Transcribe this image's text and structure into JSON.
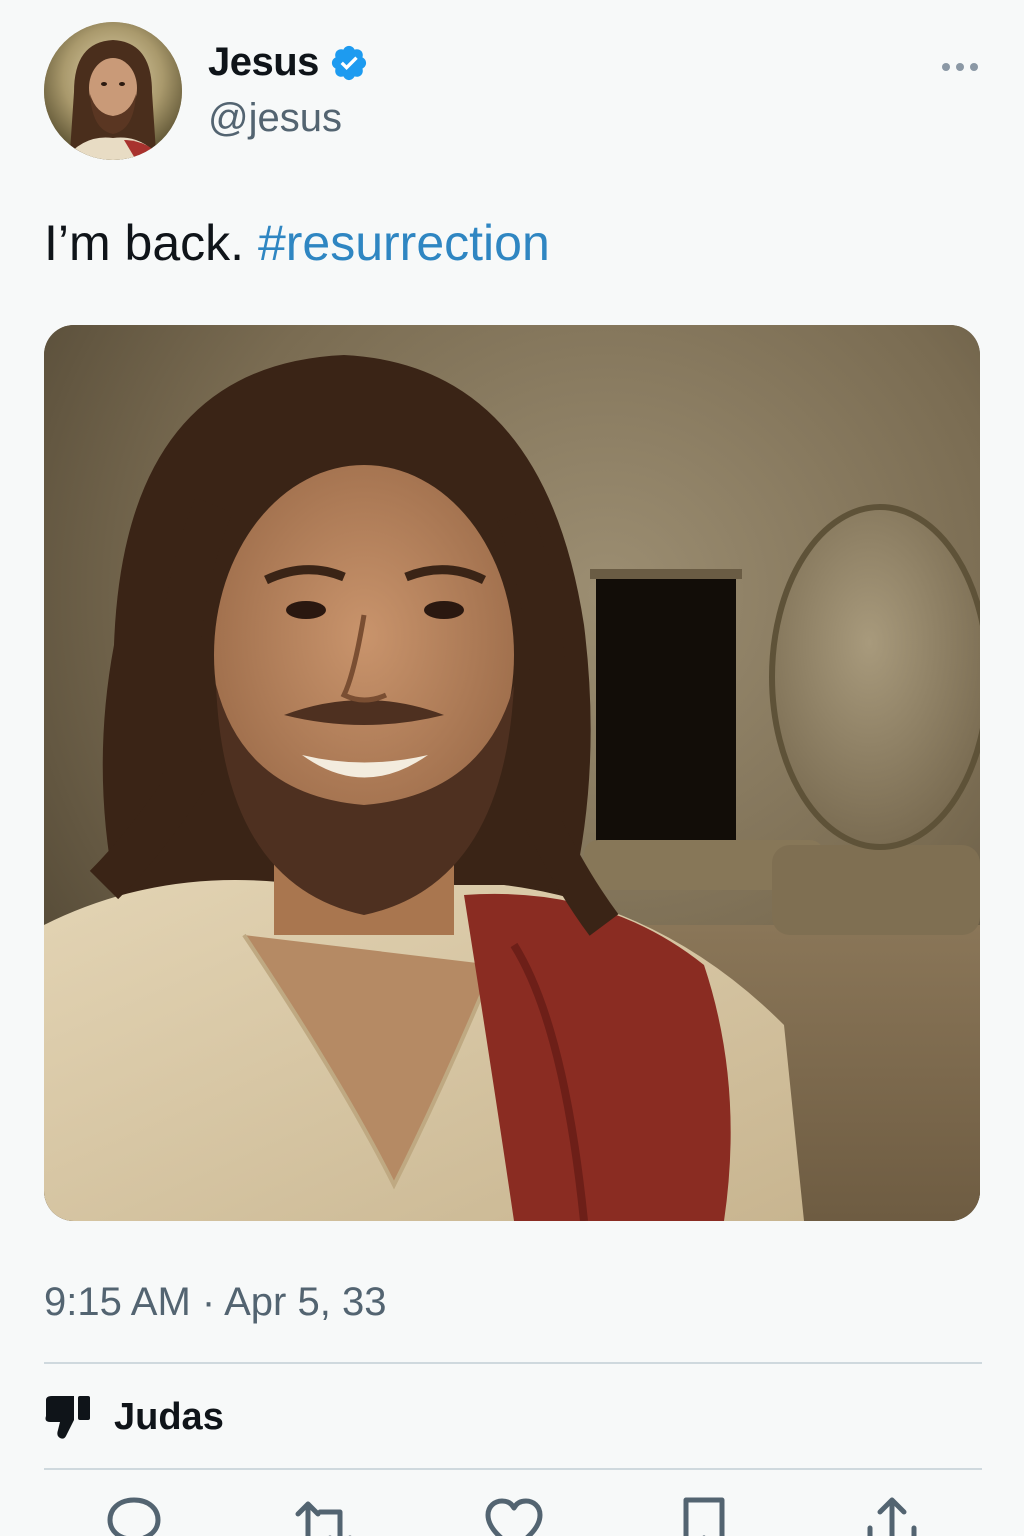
{
  "tweet": {
    "author": {
      "display_name": "Jesus",
      "handle": "@jesus",
      "verified": true,
      "avatar_icon": "user-avatar"
    },
    "text": {
      "plain": "I’m back. ",
      "hashtag": "#resurrection"
    },
    "media": {
      "type": "photo",
      "icon": "photo-image"
    },
    "timestamp": {
      "time": "9:15 AM",
      "separator": " · ",
      "date": "Apr 5, 33"
    },
    "social_context": {
      "icon": "thumbs-down-icon",
      "label": "Judas"
    },
    "actions": [
      {
        "name": "reply",
        "icon": "reply-icon"
      },
      {
        "name": "retweet",
        "icon": "retweet-icon"
      },
      {
        "name": "like",
        "icon": "heart-icon"
      },
      {
        "name": "bookmark",
        "icon": "bookmark-icon"
      },
      {
        "name": "share",
        "icon": "share-icon"
      }
    ]
  },
  "colors": {
    "background": "#f7f9f9",
    "text_primary": "#0f1419",
    "text_secondary": "#536471",
    "link": "#2f86c2",
    "verified": "#1d9bf0",
    "divider": "#cfd9de"
  }
}
